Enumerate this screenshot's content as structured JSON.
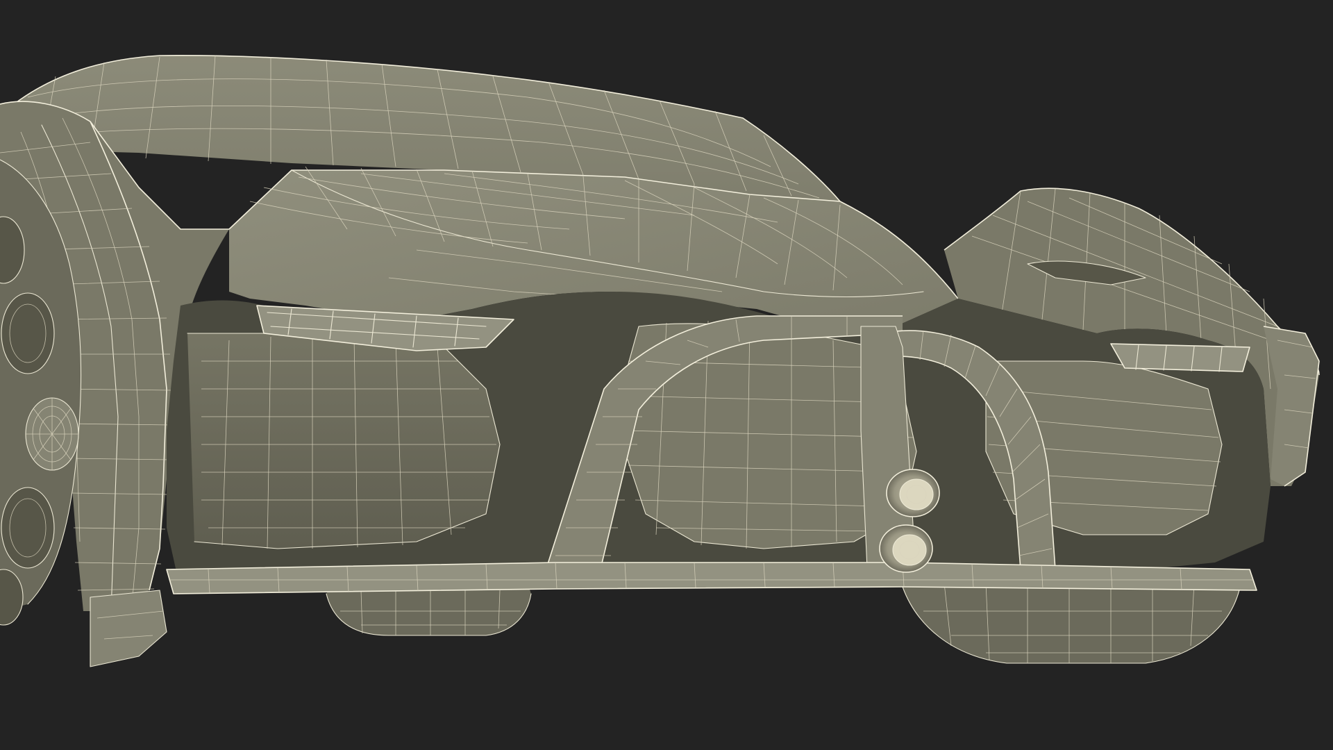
{
  "scene": {
    "subject": "sports-car-wireframe",
    "view": "front-three-quarter-low",
    "colors": {
      "background": "#232323",
      "surface": "#858473",
      "wireframe": "#ece8d4",
      "shadow": "#575648"
    }
  }
}
